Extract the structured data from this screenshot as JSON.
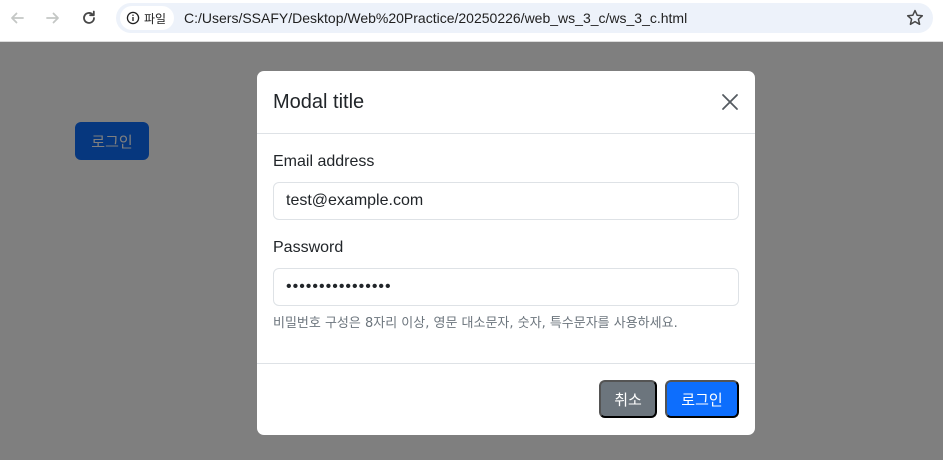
{
  "browser": {
    "site_chip_label": "파일",
    "url": "C:/Users/SSAFY/Desktop/Web%20Practice/20250226/web_ws_3_c/ws_3_c.html",
    "icons": [
      "back-arrow-icon",
      "forward-arrow-icon",
      "reload-icon",
      "info-icon",
      "star-icon"
    ]
  },
  "page": {
    "login_button_label": "로그인"
  },
  "modal": {
    "title": "Modal title",
    "email_label": "Email address",
    "email_value": "test@example.com",
    "password_label": "Password",
    "password_value": "••••••••••••••••",
    "password_help": "비밀번호 구성은 8자리 이상, 영문 대소문자, 숫자, 특수문자를 사용하세요.",
    "cancel_label": "취소",
    "submit_label": "로그인"
  },
  "colors": {
    "primary": "#0d6efd",
    "secondary": "#6c757d",
    "backdrop": "rgba(0,0,0,0.5)"
  }
}
